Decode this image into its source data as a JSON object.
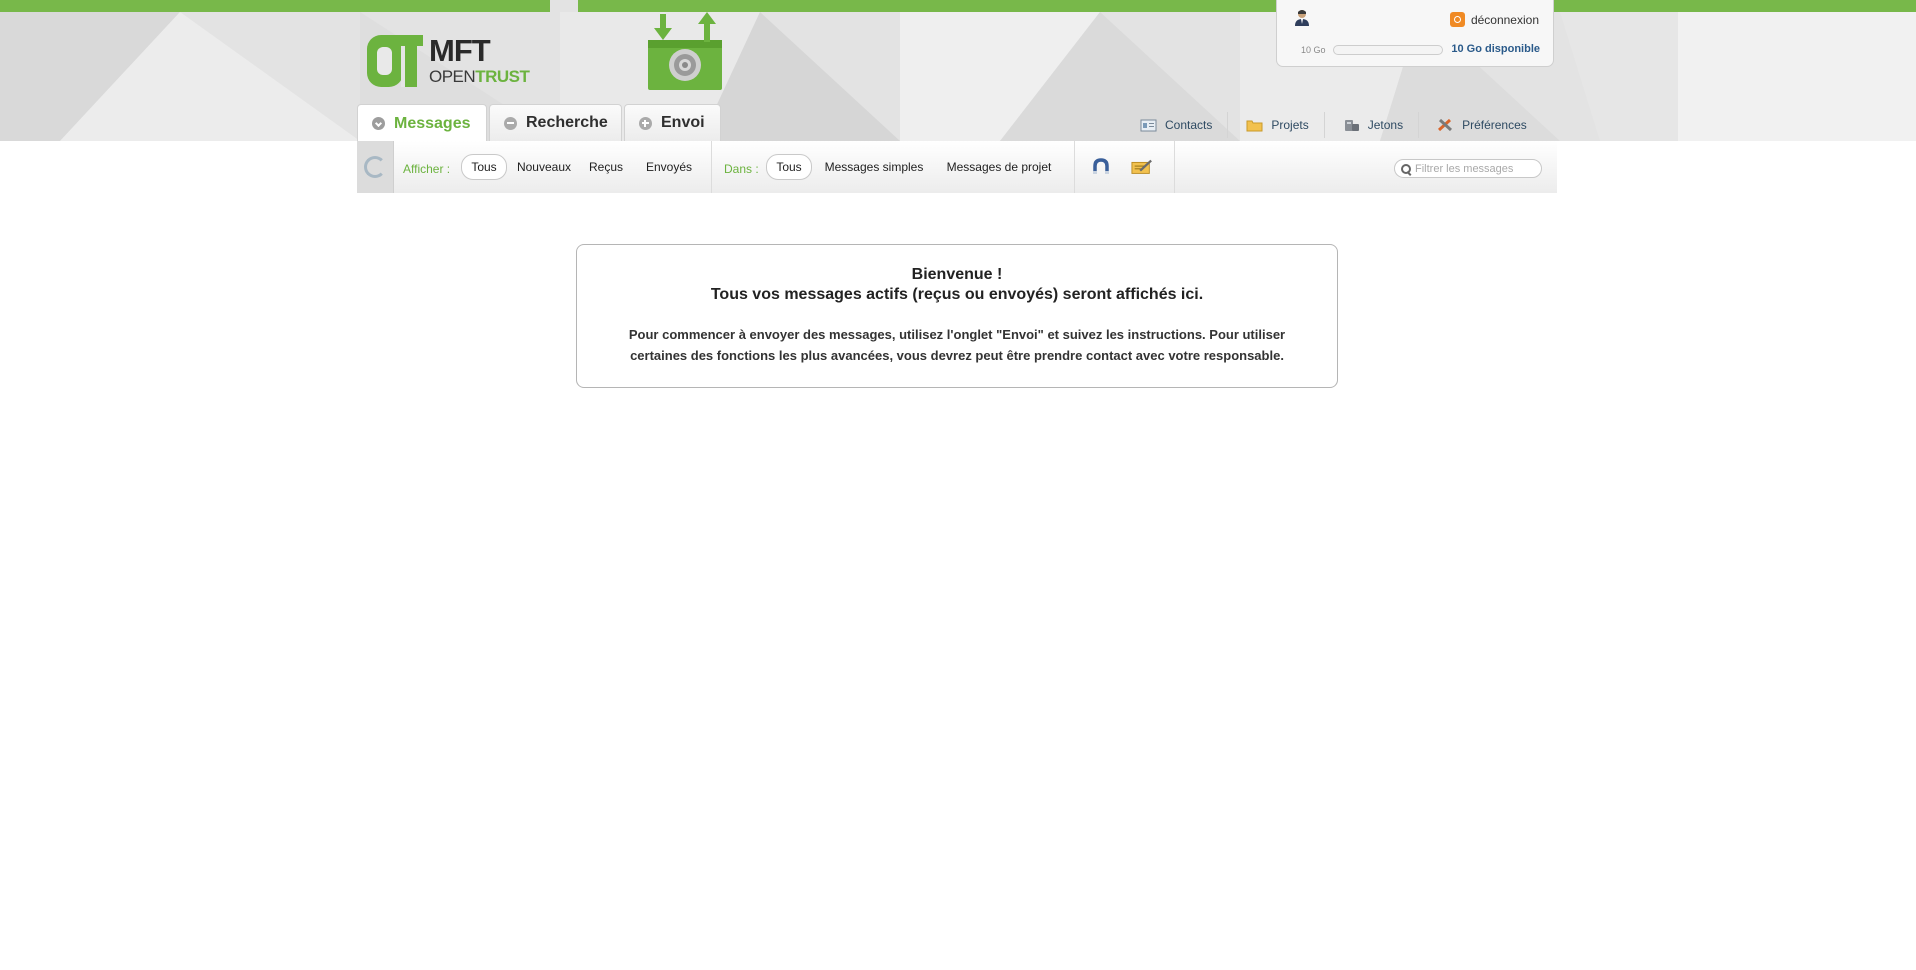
{
  "brand": {
    "name_line1": "MFT",
    "name_open": "OPEN",
    "name_trust": "TRUST"
  },
  "colors": {
    "accent_green": "#78b84a",
    "link_blue": "#2a5a8a",
    "logout_orange": "#f08a24"
  },
  "user_panel": {
    "user_icon": "user-icon",
    "logout_label": "déconnexion",
    "quota_min_label": "10 Go",
    "quota_available": "10 Go disponible",
    "quota_used_fraction": 0
  },
  "tabs": [
    {
      "label": "Messages",
      "icon": "down-circle-icon",
      "active": true
    },
    {
      "label": "Recherche",
      "icon": "minus-circle-icon",
      "active": false
    },
    {
      "label": "Envoi",
      "icon": "plus-circle-icon",
      "active": false
    }
  ],
  "secondary_nav": [
    {
      "label": "Contacts",
      "icon": "contacts-icon"
    },
    {
      "label": "Projets",
      "icon": "folder-icon"
    },
    {
      "label": "Jetons",
      "icon": "tokens-icon"
    },
    {
      "label": "Préférences",
      "icon": "tools-icon"
    }
  ],
  "toolbar": {
    "afficher_label": "Afficher :",
    "afficher_options": [
      "Tous",
      "Nouveaux",
      "Reçus",
      "Envoyés"
    ],
    "afficher_selected": "Tous",
    "dans_label": "Dans :",
    "dans_options": [
      "Tous",
      "Messages simples",
      "Messages de projet"
    ],
    "dans_selected": "Tous",
    "search_placeholder": "Filtrer les messages"
  },
  "welcome": {
    "title": "Bienvenue !",
    "subtitle": "Tous vos messages actifs (reçus ou envoyés) seront affichés ici.",
    "body": "Pour commencer à envoyer des messages, utilisez l'onglet \"Envoi\" et suivez les instructions. Pour utiliser certaines des fonctions les plus avancées, vous devrez peut être prendre contact avec votre responsable."
  }
}
